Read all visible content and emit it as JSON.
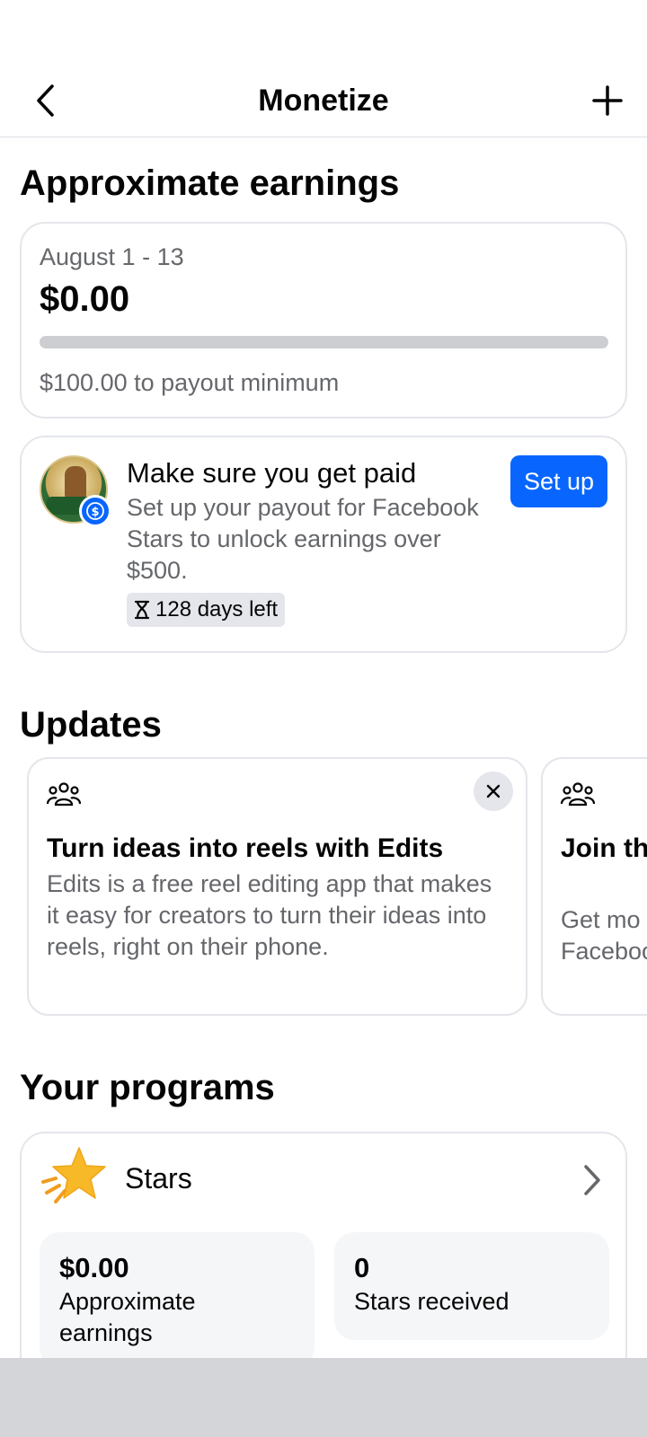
{
  "header": {
    "title": "Monetize"
  },
  "earnings": {
    "section_title": "Approximate earnings",
    "period": "August 1 - 13",
    "amount": "$0.00",
    "progress_fraction": 0.0,
    "remaining": "$100.00 to payout minimum"
  },
  "payout": {
    "headline": "Make sure you get paid",
    "body": "Set up your payout for Facebook Stars to unlock earnings over $500.",
    "days_left": "128 days left",
    "setup_label": "Set up"
  },
  "updates": {
    "section_title": "Updates",
    "cards": [
      {
        "title": "Turn ideas into reels with Edits",
        "body": "Edits is a free reel editing app that makes it easy for creators to turn their ideas into reels, right on their phone."
      },
      {
        "title": "Join th group",
        "body": "Get mo reels an Faceboo"
      }
    ]
  },
  "programs": {
    "section_title": "Your programs",
    "stars": {
      "label": "Stars",
      "earnings_value": "$0.00",
      "earnings_label": "Approximate earnings",
      "received_value": "0",
      "received_label": "Stars received"
    }
  },
  "colors": {
    "accent": "#0866ff",
    "secondary_text": "#65676b",
    "border": "#e4e6eb"
  },
  "icons": [
    "back-arrow-icon",
    "plus-icon",
    "dollar-badge-icon",
    "hourglass-icon",
    "people-icon",
    "close-icon",
    "star-icon",
    "chevron-right-icon"
  ]
}
